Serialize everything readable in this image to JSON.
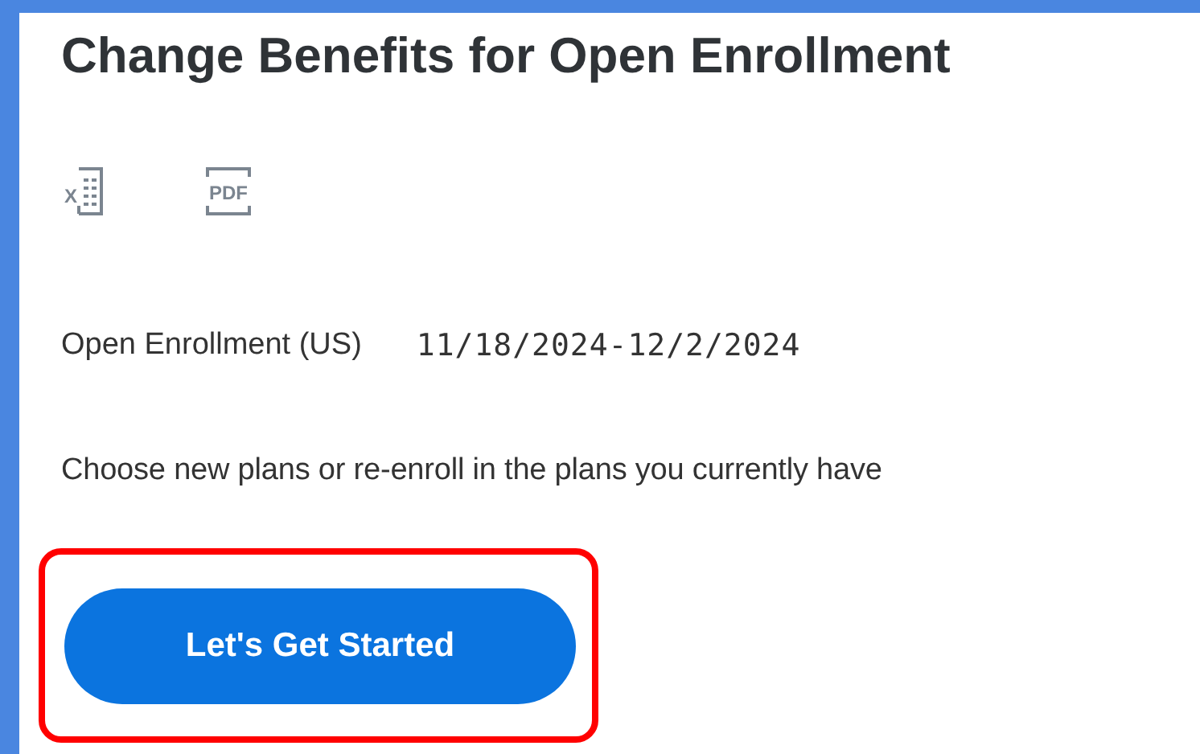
{
  "title": "Change Benefits for Open Enrollment",
  "export_icons": [
    {
      "kind": "excel",
      "glyph": "X"
    },
    {
      "kind": "pdf",
      "glyph": "PDF"
    }
  ],
  "event": {
    "label": "Open Enrollment (US)",
    "value": "11/18/2024-12/2/2024"
  },
  "instructions": "Choose new plans or re-enroll in the plans you currently have",
  "button": {
    "label": "Let's Get Started",
    "highlighted": true
  }
}
